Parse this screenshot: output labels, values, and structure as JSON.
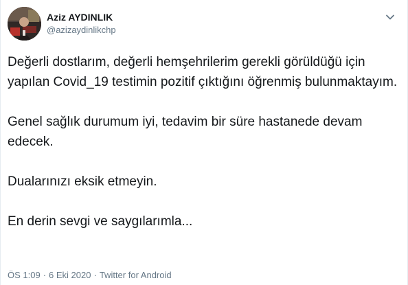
{
  "user": {
    "display_name": "Aziz AYDINLIK",
    "handle": "@azizaydinlikchp",
    "avatar_icon": "profile-photo"
  },
  "menu": {
    "icon": "chevron-down-icon",
    "color": "#657786"
  },
  "tweet": {
    "paragraphs": [
      "Değerli dostlarım, değerli hemşehrilerim gerekli görüldüğü için yapılan Covid_19 testimin pozitif çıktığını öğrenmiş bulunmaktayım.",
      "Genel sağlık durumum iyi, tedavim bir süre hastanede devam edecek.",
      "Dualarınızı eksik etmeyin.",
      "En derin sevgi ve saygılarımla..."
    ]
  },
  "meta": {
    "time": "ÖS 1:09",
    "separator": "·",
    "date": "6 Eki 2020",
    "source": "Twitter for Android"
  },
  "colors": {
    "text": "#14171a",
    "secondary": "#657786",
    "border": "#e6ecf0"
  }
}
